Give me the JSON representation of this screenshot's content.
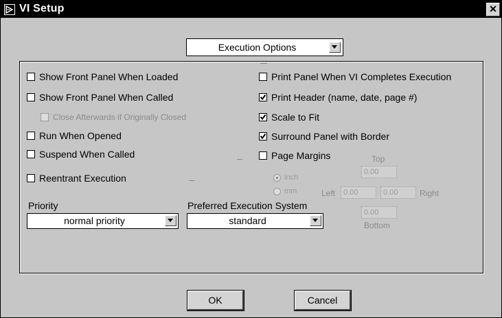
{
  "window": {
    "title": "VI Setup",
    "close_glyph": "✕"
  },
  "category_select": {
    "value": "Execution Options"
  },
  "left_options": [
    {
      "label": "Show Front Panel When Loaded",
      "checked": false
    },
    {
      "label": "Show Front Panel When Called",
      "checked": false
    },
    {
      "label": "Close Afterwards if Originally Closed",
      "checked": false,
      "disabled": true
    },
    {
      "label": "Run When Opened",
      "checked": false
    },
    {
      "label": "Suspend When Called",
      "checked": false
    },
    {
      "label": "Reentrant Execution",
      "checked": false
    }
  ],
  "right_options": [
    {
      "label": "Print Panel When VI Completes Execution",
      "checked": false
    },
    {
      "label": "Print Header (name, date, page #)",
      "checked": true
    },
    {
      "label": "Scale to Fit",
      "checked": true
    },
    {
      "label": "Surround Panel with Border",
      "checked": true
    },
    {
      "label": "Page Margins",
      "checked": false
    }
  ],
  "margins": {
    "units": [
      {
        "label": "inch",
        "selected": true
      },
      {
        "label": "mm",
        "selected": false
      }
    ],
    "top_label": "Top",
    "left_label": "Left",
    "right_label": "Right",
    "bottom_label": "Bottom",
    "top": "0.00",
    "left": "0.00",
    "right": "0.00",
    "bottom": "0.00"
  },
  "priority": {
    "label": "Priority",
    "value": "normal priority"
  },
  "exec_system": {
    "label": "Preferred Execution System",
    "value": "standard"
  },
  "buttons": {
    "ok": "OK",
    "cancel": "Cancel"
  }
}
